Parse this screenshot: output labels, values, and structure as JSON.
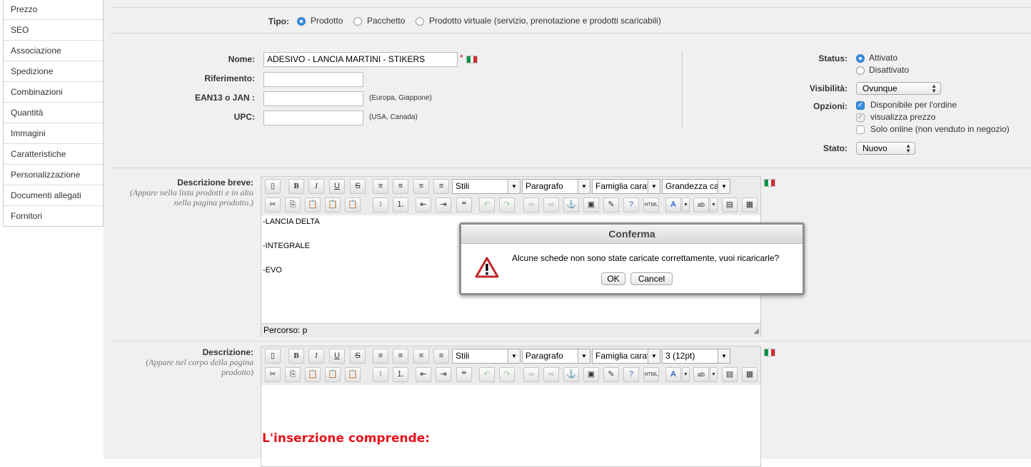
{
  "sidebar": {
    "items": [
      "Prezzo",
      "SEO",
      "Associazione",
      "Spedizione",
      "Combinazioni",
      "Quantità",
      "Immagini",
      "Caratteristiche",
      "Personalizzazione",
      "Documenti allegati",
      "Fornitori"
    ]
  },
  "tipo": {
    "label": "Tipo:",
    "options": [
      "Prodotto",
      "Pacchetto",
      "Prodotto virtuale (servizio, prenotazione e prodotti scaricabili)"
    ],
    "selected": "Prodotto"
  },
  "form": {
    "nome_label": "Nome:",
    "nome_value": "ADESIVO - LANCIA MARTINI - STIKERS",
    "required_mark": "*",
    "riferimento_label": "Riferimento:",
    "riferimento_value": "",
    "ean_label": "EAN13 o JAN :",
    "ean_value": "",
    "ean_hint": "(Europa, Giappone)",
    "upc_label": "UPC:",
    "upc_value": "",
    "upc_hint": "(USA, Canada)"
  },
  "status": {
    "label": "Status:",
    "options": [
      "Attivato",
      "Disattivato"
    ],
    "selected": "Attivato"
  },
  "visibilita": {
    "label": "Visibilità:",
    "value": "Ovunque"
  },
  "opzioni": {
    "label": "Opzioni:",
    "items": [
      {
        "label": "Disponibile per l'ordine",
        "checked": true
      },
      {
        "label": "visualizza prezzo",
        "checked": true
      },
      {
        "label": "Solo online (non venduto in negozio)",
        "checked": false
      }
    ]
  },
  "stato": {
    "label": "Stato:",
    "value": "Nuovo"
  },
  "desc_breve": {
    "label": "Descrizione breve:",
    "hint": "(Appare nella lista prodotti e in alto nella pagina prodotto.)",
    "toolbar": {
      "stili": "Stili",
      "formato": "Paragrafo",
      "famiglia": "Famiglia caratt",
      "grandezza": "Grandezza cara"
    },
    "lines": [
      "-LANCIA DELTA",
      "-INTEGRALE",
      "-EVO"
    ],
    "path": "Percorso: p"
  },
  "descrizione": {
    "label": "Descrizione:",
    "hint": "(Appare nel corpo della pagina prodotto)",
    "toolbar": {
      "stili": "Stili",
      "formato": "Paragrafo",
      "famiglia": "Famiglia caratt",
      "grandezza": "3 (12pt)"
    },
    "heading": "L'inserzione comprende:",
    "heading_color": "#e8141c"
  },
  "dialog": {
    "title": "Conferma",
    "message": "Alcune schede non sono state caricate correttamente, vuoi ricaricarle?",
    "ok": "OK",
    "cancel": "Cancel"
  },
  "colors": {
    "accent": "#3b8fe0",
    "panel": "#f0f0f0"
  }
}
